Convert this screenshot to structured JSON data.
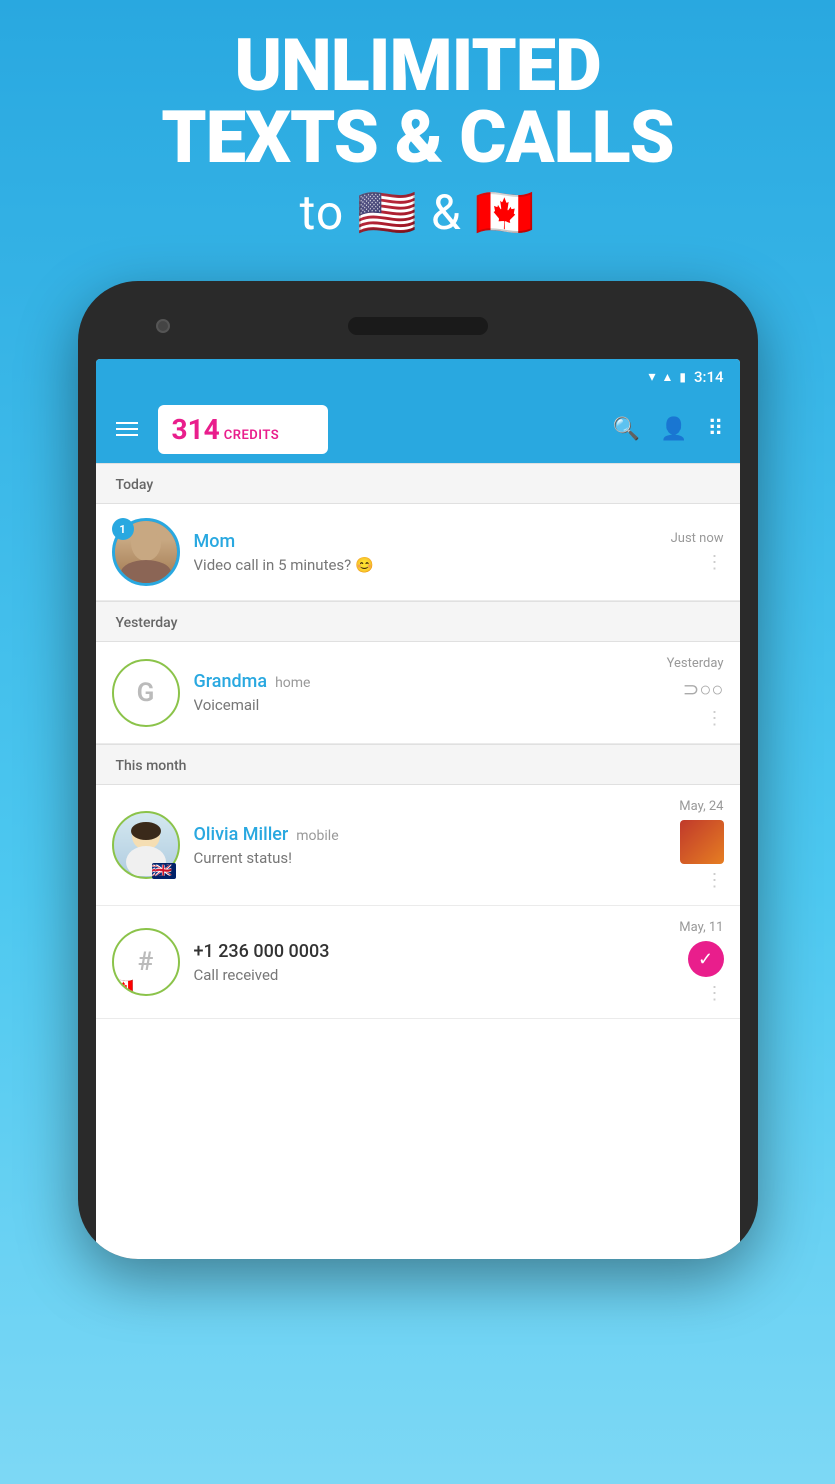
{
  "promo": {
    "line1": "UNLIMITED",
    "line2": "TEXTS & CALLS",
    "subtitle": "to 🇺🇸 & 🇨🇦"
  },
  "status_bar": {
    "time": "3:14"
  },
  "app_bar": {
    "menu_label": "menu",
    "credits_number": "314",
    "credits_label": "CREDITS",
    "search_label": "search",
    "contacts_label": "contacts",
    "dialpad_label": "dialpad"
  },
  "sections": [
    {
      "header": "Today",
      "contacts": [
        {
          "name": "Mom",
          "type": "",
          "message": "Video call in 5 minutes? 😊",
          "time": "Just now",
          "badge": "1",
          "avatar_type": "photo_mom",
          "avatar_letter": "",
          "has_voicemail": false,
          "has_image": false,
          "has_call_received": false
        }
      ]
    },
    {
      "header": "Yesterday",
      "contacts": [
        {
          "name": "Grandma",
          "type": "home",
          "message": "Voicemail",
          "time": "Yesterday",
          "badge": "",
          "avatar_type": "letter",
          "avatar_letter": "G",
          "has_voicemail": true,
          "has_image": false,
          "has_call_received": false
        }
      ]
    },
    {
      "header": "This month",
      "contacts": [
        {
          "name": "Olivia Miller",
          "type": "mobile",
          "message": "Current status!",
          "time": "May, 24",
          "badge": "",
          "avatar_type": "photo_olivia",
          "avatar_letter": "",
          "has_voicemail": false,
          "has_image": true,
          "has_call_received": false
        },
        {
          "name": "+1 236 000 0003",
          "type": "",
          "message": "Call received",
          "time": "May, 11",
          "badge": "",
          "avatar_type": "hash",
          "avatar_letter": "#",
          "has_voicemail": false,
          "has_image": false,
          "has_call_received": true
        }
      ]
    }
  ]
}
